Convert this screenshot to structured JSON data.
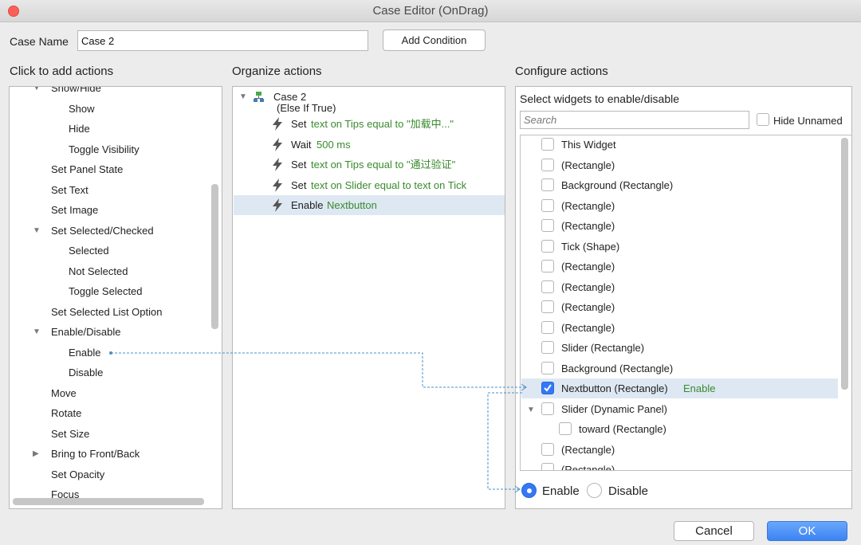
{
  "window": {
    "title": "Case Editor (OnDrag)"
  },
  "case_name": {
    "label": "Case Name",
    "value": "Case 2"
  },
  "buttons": {
    "add_condition": "Add Condition",
    "cancel": "Cancel",
    "ok": "OK"
  },
  "sections": {
    "left": "Click to add actions",
    "middle": "Organize actions",
    "right": "Configure actions"
  },
  "left_tree": [
    {
      "label": "Show/Hide",
      "expanded": true,
      "level": 0
    },
    {
      "label": "Show",
      "level": 1
    },
    {
      "label": "Hide",
      "level": 1
    },
    {
      "label": "Toggle Visibility",
      "level": 1
    },
    {
      "label": "Set Panel State",
      "level": 0
    },
    {
      "label": "Set Text",
      "level": 0
    },
    {
      "label": "Set Image",
      "level": 0
    },
    {
      "label": "Set Selected/Checked",
      "expanded": true,
      "level": 0
    },
    {
      "label": "Selected",
      "level": 1
    },
    {
      "label": "Not Selected",
      "level": 1
    },
    {
      "label": "Toggle Selected",
      "level": 1
    },
    {
      "label": "Set Selected List Option",
      "level": 0
    },
    {
      "label": "Enable/Disable",
      "expanded": true,
      "level": 0
    },
    {
      "label": "Enable",
      "level": 1
    },
    {
      "label": "Disable",
      "level": 1
    },
    {
      "label": "Move",
      "level": 0
    },
    {
      "label": "Rotate",
      "level": 0
    },
    {
      "label": "Set Size",
      "level": 0
    },
    {
      "label": "Bring to Front/Back",
      "collapsed": true,
      "level": 0
    },
    {
      "label": "Set Opacity",
      "level": 0
    },
    {
      "label": "Focus",
      "level": 0
    }
  ],
  "organize": {
    "case_label": "Case 2",
    "case_condition": "(Else If True)",
    "actions": [
      {
        "verb": "Set",
        "detail": "text on Tips equal to \"加载中...\""
      },
      {
        "verb": "Wait",
        "detail": "500 ms"
      },
      {
        "verb": "Set",
        "detail": "text on Tips equal to \"通过验证\""
      },
      {
        "verb": "Set",
        "detail": "text on Slider equal to text on Tick"
      },
      {
        "verb": "Enable",
        "detail": "Nextbutton",
        "selected": true
      }
    ]
  },
  "configure": {
    "heading": "Select widgets to enable/disable",
    "search_placeholder": "Search",
    "hide_unnamed": "Hide Unnamed",
    "widgets": [
      {
        "label": "This Widget"
      },
      {
        "label": "(Rectangle)"
      },
      {
        "label": "Background (Rectangle)"
      },
      {
        "label": "(Rectangle)"
      },
      {
        "label": "(Rectangle)"
      },
      {
        "label": "Tick (Shape)"
      },
      {
        "label": "(Rectangle)"
      },
      {
        "label": "(Rectangle)"
      },
      {
        "label": "(Rectangle)"
      },
      {
        "label": "(Rectangle)"
      },
      {
        "label": "Slider (Rectangle)"
      },
      {
        "label": "Background (Rectangle)"
      },
      {
        "label": "Nextbutton (Rectangle)",
        "checked": true,
        "tag": "Enable",
        "selected": true
      },
      {
        "label": "Slider (Dynamic Panel)",
        "expanded": true
      },
      {
        "label": "toward (Rectangle)",
        "child": true
      },
      {
        "label": "(Rectangle)"
      },
      {
        "label": "(Rectangle)"
      }
    ],
    "radio_enable": "Enable",
    "radio_disable": "Disable",
    "selected_radio": "Enable"
  },
  "colors": {
    "accent": "#3478f6",
    "action_detail": "#3a8a2e",
    "connector": "#4a90c8"
  }
}
